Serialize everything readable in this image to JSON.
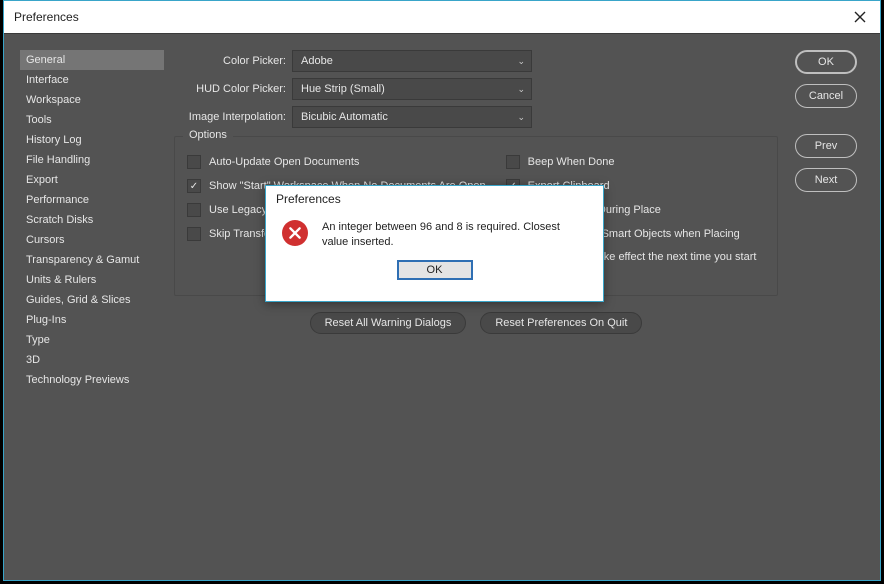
{
  "window": {
    "title": "Preferences"
  },
  "sidebar": {
    "items": [
      {
        "label": "General",
        "active": true
      },
      {
        "label": "Interface"
      },
      {
        "label": "Workspace"
      },
      {
        "label": "Tools"
      },
      {
        "label": "History Log"
      },
      {
        "label": "File Handling"
      },
      {
        "label": "Export"
      },
      {
        "label": "Performance"
      },
      {
        "label": "Scratch Disks"
      },
      {
        "label": "Cursors"
      },
      {
        "label": "Transparency & Gamut"
      },
      {
        "label": "Units & Rulers"
      },
      {
        "label": "Guides, Grid & Slices"
      },
      {
        "label": "Plug-Ins"
      },
      {
        "label": "Type"
      },
      {
        "label": "3D"
      },
      {
        "label": "Technology Previews"
      }
    ]
  },
  "form": {
    "color_picker": {
      "label": "Color Picker:",
      "value": "Adobe"
    },
    "hud_picker": {
      "label": "HUD Color Picker:",
      "value": "Hue Strip (Small)"
    },
    "interpolation": {
      "label": "Image Interpolation:",
      "value": "Bicubic Automatic"
    }
  },
  "options": {
    "legend": "Options",
    "left": [
      {
        "label": "Auto-Update Open Documents",
        "checked": false
      },
      {
        "label": "Show \"Start\" Workspace When No Documents Are Open",
        "checked": true
      },
      {
        "label": "Use Legacy \"New Document\" Interface",
        "checked": false
      },
      {
        "label": "Skip Transform when Placing",
        "checked": false
      }
    ],
    "right": [
      {
        "label": "Beep When Done",
        "checked": false
      },
      {
        "label": "Export Clipboard",
        "checked": true
      },
      {
        "label": "Resize Image During Place",
        "checked": true
      },
      {
        "label": "Always Create Smart Objects when Placing",
        "checked": true
      }
    ],
    "note": "Changes will take effect the next time you start Photoshop."
  },
  "reset": {
    "warnings": "Reset All Warning Dialogs",
    "on_quit": "Reset Preferences On Quit"
  },
  "buttons": {
    "ok": "OK",
    "cancel": "Cancel",
    "prev": "Prev",
    "next": "Next"
  },
  "modal": {
    "title": "Preferences",
    "message": "An integer between 96 and 8 is required.  Closest value inserted.",
    "ok": "OK"
  }
}
